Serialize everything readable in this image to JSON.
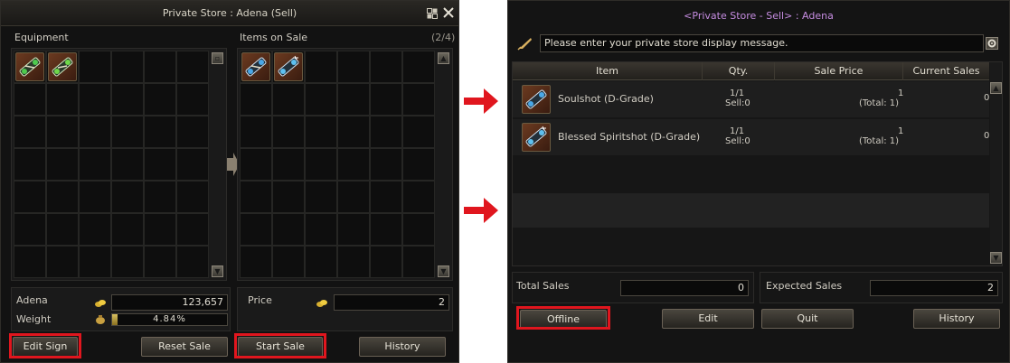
{
  "colors": {
    "highlight": "#e0161e",
    "title_purple": "#c58ce0",
    "arrow_red": "#e0161e"
  },
  "left_window": {
    "title": "Private Store : Adena (Sell)",
    "equipment_label": "Equipment",
    "items_on_sale_label": "Items on Sale",
    "items_on_sale_count": "(2/4)",
    "equipment_items": [
      {
        "icon": "soulshot-green-icon"
      },
      {
        "icon": "spiritshot-green-icon"
      }
    ],
    "sale_items": [
      {
        "icon": "soulshot-blue-icon"
      },
      {
        "icon": "blessed-spiritshot-blue-icon"
      }
    ],
    "adena_label": "Adena",
    "adena_value": "123,657",
    "weight_label": "Weight",
    "weight_value": "4.84%",
    "weight_fraction": 0.0484,
    "price_label": "Price",
    "price_value": "2",
    "buttons": {
      "edit_sign": "Edit Sign",
      "reset_sale": "Reset Sale",
      "start_sale": "Start Sale",
      "history": "History"
    }
  },
  "right_window": {
    "title": "<Private Store - Sell> : Adena",
    "message_placeholder": "Please enter your private store display message.",
    "columns": [
      "Item",
      "Qty.",
      "Sale Price",
      "Current Sales"
    ],
    "rows": [
      {
        "name": "Soulshot (D-Grade)",
        "qty": "1/1",
        "sell": "Sell:0",
        "price": "1",
        "total": "(Total: 1)",
        "current": "0",
        "icon": "soulshot-blue-icon"
      },
      {
        "name": "Blessed Spiritshot (D-Grade)",
        "qty": "1/1",
        "sell": "Sell:0",
        "price": "1",
        "total": "(Total: 1)",
        "current": "0",
        "icon": "blessed-spiritshot-blue-icon"
      }
    ],
    "total_sales_label": "Total Sales",
    "total_sales_value": "0",
    "expected_sales_label": "Expected Sales",
    "expected_sales_value": "2",
    "buttons": {
      "offline": "Offline",
      "edit": "Edit",
      "quit": "Quit",
      "history": "History"
    }
  }
}
